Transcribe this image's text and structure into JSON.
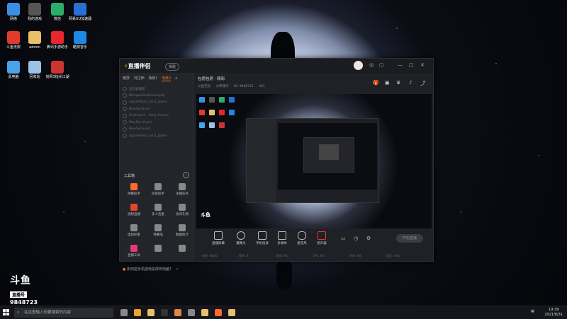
{
  "desktop": {
    "icons": [
      {
        "label": "网络",
        "color": "#3b8fe0"
      },
      {
        "label": "我的游戏",
        "color": "#555"
      },
      {
        "label": "微信",
        "color": "#2aae67"
      },
      {
        "label": "网易UU加速器",
        "color": "#2a6fd6"
      },
      {
        "label": "斗鱼无限",
        "color": "#e23a2d"
      },
      {
        "label": "admin",
        "color": "#e8c06a"
      },
      {
        "label": "腾讯手游助手",
        "color": "#e8262b"
      },
      {
        "label": "酷狗音乐",
        "color": "#1e88e5"
      },
      {
        "label": "此电脑",
        "color": "#4aa3e8"
      },
      {
        "label": "回收站",
        "color": "#9cc3e6"
      },
      {
        "label": "剑网3指尖江湖",
        "color": "#c33"
      }
    ]
  },
  "app": {
    "title": "直播伴侣",
    "version_badge": "体验",
    "window_controls": [
      "◎",
      "▢",
      "—",
      "□",
      "✕"
    ],
    "tabs": [
      {
        "label": "宽屏",
        "active": false
      },
      {
        "label": "可拉伸",
        "active": false
      },
      {
        "label": "场景1",
        "active": false
      },
      {
        "label": "场景2",
        "active": true
      }
    ],
    "add_tab": "+",
    "scenes": [
      "显示器捕获",
      "WeaponShotGameplay",
      "raptaRShot_van1_game",
      "NewSurvived",
      "Overcome - Early Access",
      "WayRon Overs",
      "NewSurvived",
      "raptaRShot_van1_game"
    ],
    "toolbox": {
      "header": "工具箱",
      "more": "···",
      "tools": [
        {
          "label": "弹幕助手",
          "color": "#ff6b2b"
        },
        {
          "label": "房管助手",
          "color": "#888"
        },
        {
          "label": "主播任务",
          "color": "#888"
        },
        {
          "label": "视频直播",
          "color": "#e2462d"
        },
        {
          "label": "多人连麦",
          "color": "#888"
        },
        {
          "label": "房间礼物",
          "color": "#888"
        },
        {
          "label": "虚拟形象",
          "color": "#888"
        },
        {
          "label": "弹幕墙",
          "color": "#888"
        },
        {
          "label": "数据统计",
          "color": "#888"
        },
        {
          "label": "直播工具",
          "color": "#e23a7a"
        },
        {
          "label": "",
          "color": "#888"
        },
        {
          "label": "",
          "color": "#888"
        }
      ]
    },
    "tip": "如何把手机游戏投屏到电脑?",
    "room": {
      "title": "包房包房 · 精彩",
      "sub": [
        "斗鱼无双",
        "大神操作",
        "ID: 9848723",
        "341"
      ]
    },
    "preview_watermark": "斗鱼",
    "controls": [
      {
        "label": "直播屏幕"
      },
      {
        "label": "摄像头"
      },
      {
        "label": "手机投屏"
      },
      {
        "label": "多媒体"
      },
      {
        "label": "麦克风"
      },
      {
        "label": "扬声器"
      }
    ],
    "start_button": "开始直播",
    "status": [
      "码率: 0kb/s",
      "帧率: 0",
      "丢帧: 0%",
      "CPU: 0%",
      "内存: 0%",
      "延迟: 0ms"
    ]
  },
  "watermark": {
    "logo": "斗鱼",
    "sub": "直播号",
    "room_number": "9848723"
  },
  "taskbar": {
    "search_placeholder": "在这里输入你要搜索的内容",
    "time": "19:39",
    "date": "2021/8/31",
    "lang": "英",
    "app_colors": [
      "#888",
      "#f0a030",
      "#e8c06a",
      "#333",
      "#d84",
      "#888",
      "#e8c06a",
      "#ff6b2b",
      "#e8c06a"
    ]
  }
}
